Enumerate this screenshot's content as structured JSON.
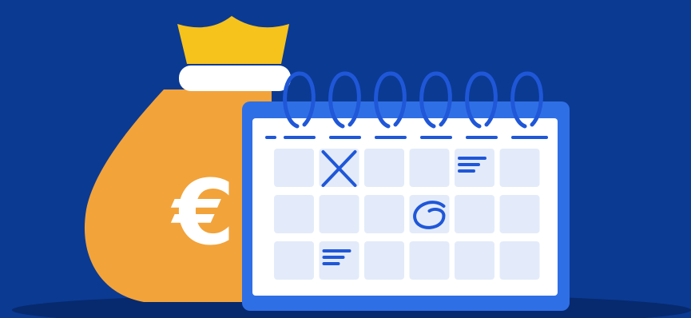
{
  "illustration": {
    "currency_symbol": "€",
    "colors": {
      "background": "#0b3a93",
      "shadow": "#072a6e",
      "bag": "#f2a33a",
      "bag_tie": "#f6c21c",
      "bag_band": "#ffffff",
      "calendar_frame": "#2f6fe6",
      "calendar_page": "#ffffff",
      "calendar_cell": "#e3ebfa",
      "ink": "#1f57d8"
    },
    "calendar": {
      "rows": 3,
      "columns": 6,
      "ring_count": 6,
      "marks": [
        {
          "row": 0,
          "col": 1,
          "type": "cross"
        },
        {
          "row": 0,
          "col": 4,
          "type": "lines"
        },
        {
          "row": 1,
          "col": 3,
          "type": "circle"
        },
        {
          "row": 2,
          "col": 1,
          "type": "lines"
        }
      ]
    }
  }
}
